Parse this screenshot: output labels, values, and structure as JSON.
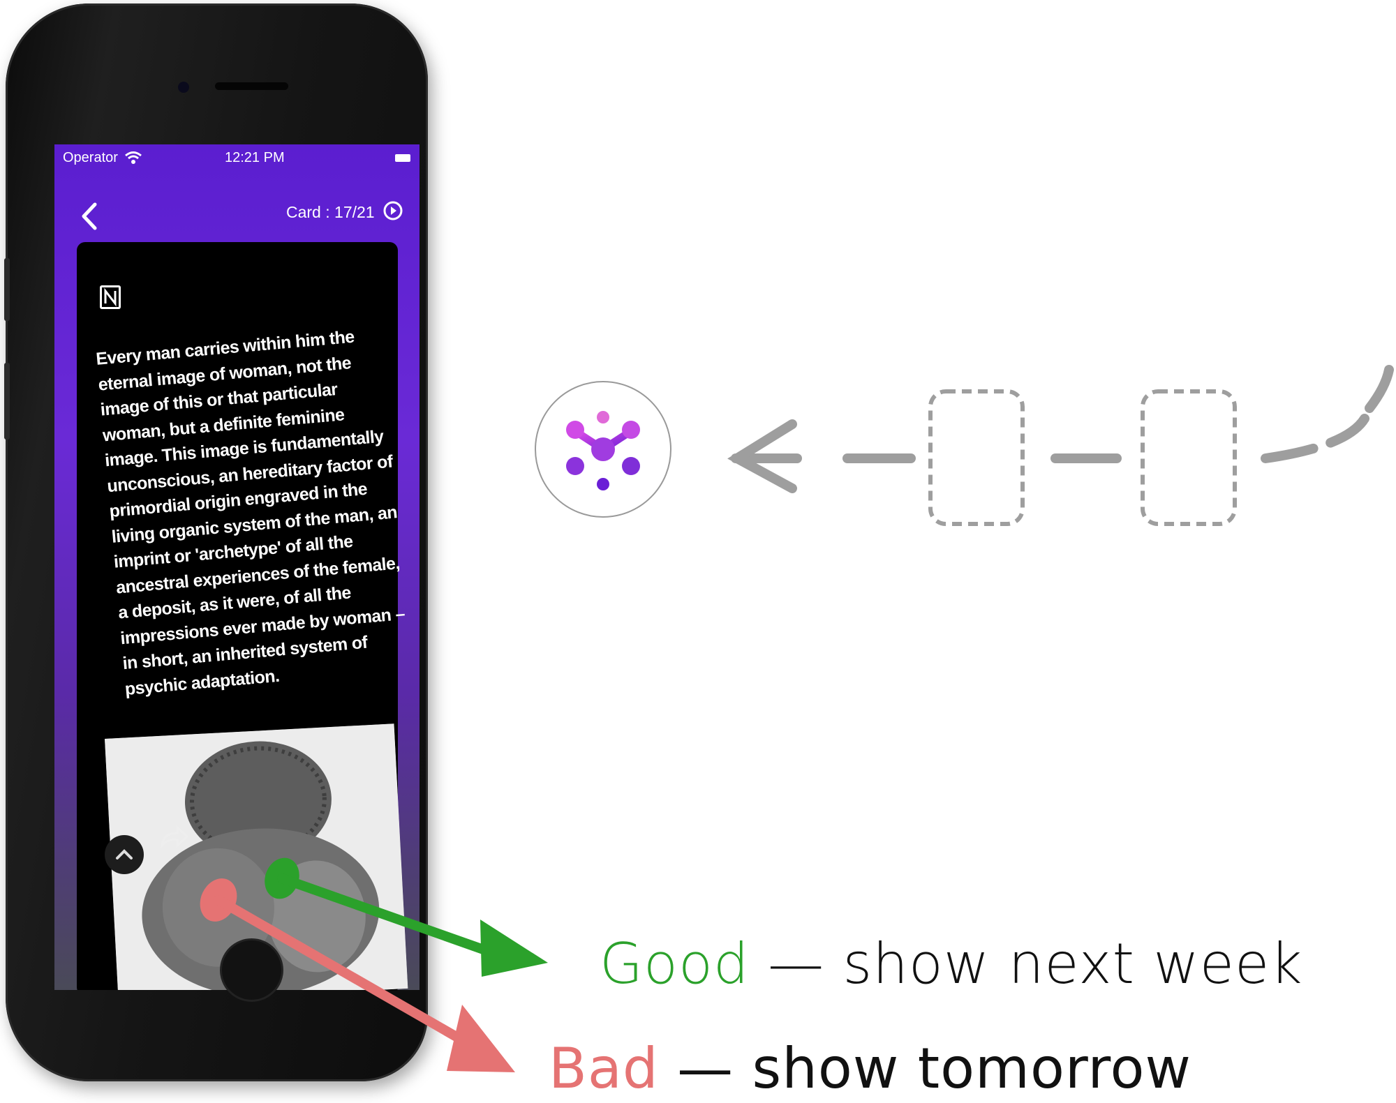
{
  "phone": {
    "status_bar": {
      "carrier": "Operator",
      "time": "12:21 PM"
    },
    "header": {
      "card_counter": "Card : 17/21"
    },
    "card": {
      "text": "Every man carries within him the eternal image of woman, not the image of this or that particular woman, but a definite feminine image. This image is fundamentally unconscious, an hereditary factor of primordial origin engraved in the living organic system of the man, an imprint or 'archetype' of all the ancestral experiences of the female, a deposit, as it were, of all the impressions ever made by woman – in short, an inherited system of psychic adaptation."
    }
  },
  "labels": {
    "good_word": "Good",
    "good_rest": " — show next week",
    "bad_word": "Bad",
    "bad_rest": " — show tomorrow"
  },
  "colors": {
    "good": "#2ba12b",
    "bad": "#e57373",
    "accent_purple": "#6a2ad6",
    "flow_gray": "#9e9e9e"
  },
  "icons": [
    "wifi-icon",
    "back-chevron-icon",
    "play-icon",
    "notion-icon",
    "chevron-up-icon",
    "share-icon",
    "app-logo-icon",
    "arrow-left-icon"
  ]
}
